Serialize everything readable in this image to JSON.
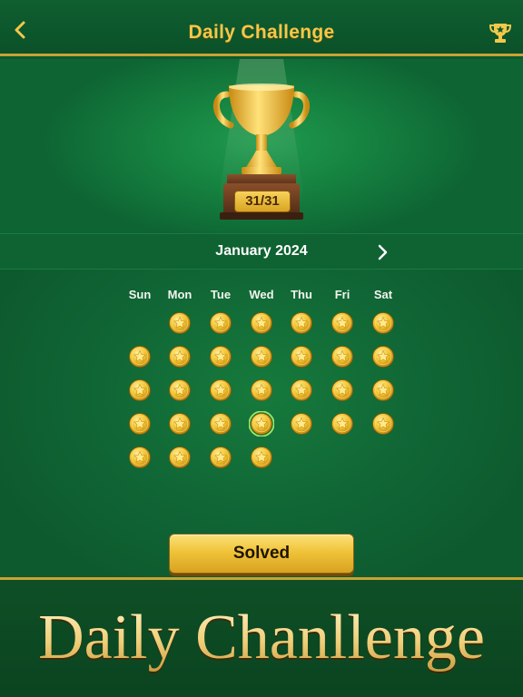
{
  "header": {
    "title": "Daily Challenge",
    "back_icon": "chevron-left-icon",
    "trophy_icon": "trophy-star-icon"
  },
  "hero": {
    "trophy_icon": "gold-cup-trophy",
    "score": "31/31"
  },
  "calendar": {
    "month_label": "January 2024",
    "next_icon": "chevron-right-icon",
    "weekdays": [
      "Sun",
      "Mon",
      "Tue",
      "Wed",
      "Thu",
      "Fri",
      "Sat"
    ],
    "first_weekday_index": 1,
    "days_in_month": 31,
    "completed_days": 31,
    "selected_day": 24,
    "day_icon": "gold-star-coin"
  },
  "solved_button": {
    "label": "Solved"
  },
  "banner": {
    "text": "Daily Chanllenge"
  },
  "colors": {
    "felt_green": "#0d5a2e",
    "gold": "#f0c339",
    "accent_title": "#f3c84a",
    "selected_ring": "#9be86a"
  }
}
